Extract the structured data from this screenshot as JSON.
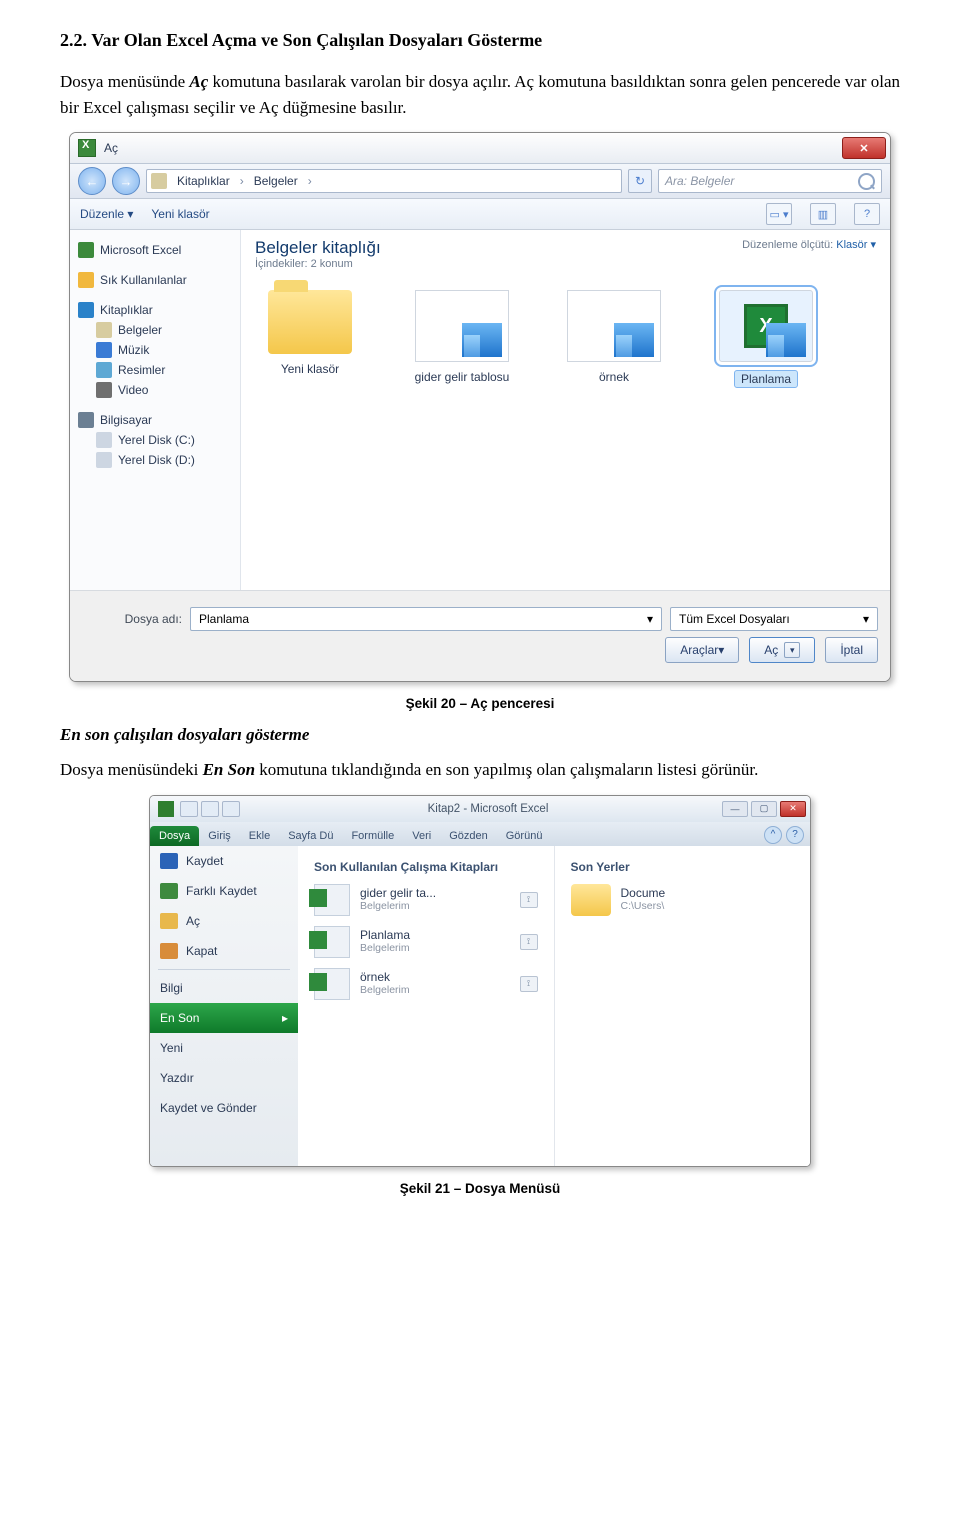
{
  "section": {
    "number": "2.2.",
    "title": "Var  Olan Excel Açma ve Son Çalışılan Dosyaları Gösterme"
  },
  "para1_a": "Dosya menüsünde ",
  "para1_ac": "Aç",
  "para1_b": "  komutuna basılarak varolan bir dosya açılır. Aç komutuna basıldıktan sonra gelen pencerede var olan bir Excel çalışması seçilir ve Aç düğmesine basılır.",
  "fig20_caption": "Şekil 20 – Aç penceresi",
  "subheading": "En son çalışılan dosyaları gösterme",
  "para2_a": "Dosya menüsündeki ",
  "para2_en": "En Son",
  "para2_b": " komutuna tıklandığında en son yapılmış olan çalışmaların listesi görünür.",
  "fig21_caption": "Şekil 21 – Dosya Menüsü",
  "dlg": {
    "title": "Aç",
    "back": "←",
    "fwd": "→",
    "crumbs": [
      "Kitaplıklar",
      "Belgeler"
    ],
    "search_placeholder": "Ara: Belgeler",
    "tools": {
      "organize": "Düzenle ▾",
      "newfolder": "Yeni klasör"
    },
    "lib": {
      "title": "Belgeler kitaplığı",
      "subtitle": "İçindekiler:  2 konum",
      "sort_label": "Düzenleme ölçütü:",
      "sort_value": "Klasör ▾"
    },
    "nav": [
      {
        "t": "Microsoft Excel",
        "cls": "i-xl"
      },
      {
        "t": "Sık Kullanılanlar",
        "cls": "i-star"
      },
      {
        "t": "Kitaplıklar",
        "cls": "i-lib"
      },
      {
        "t": "Belgeler",
        "cls": "i-doc",
        "child": true
      },
      {
        "t": "Müzik",
        "cls": "i-mus",
        "child": true
      },
      {
        "t": "Resimler",
        "cls": "i-pic",
        "child": true
      },
      {
        "t": "Video",
        "cls": "i-vid",
        "child": true
      },
      {
        "t": "Bilgisayar",
        "cls": "i-pc"
      },
      {
        "t": "Yerel Disk (C:)",
        "cls": "i-dsk",
        "child": true
      },
      {
        "t": "Yerel Disk (D:)",
        "cls": "i-dsk",
        "child": true
      }
    ],
    "items": [
      {
        "label": "Yeni klasör",
        "type": "folder"
      },
      {
        "label": "gider gelir tablosu",
        "type": "wb"
      },
      {
        "label": "örnek",
        "type": "wb"
      },
      {
        "label": "Planlama",
        "type": "wb-xl",
        "selected": true
      }
    ],
    "file_label": "Dosya adı:",
    "file_value": "Planlama",
    "filter": "Tüm Excel Dosyaları",
    "tools_btn": "Araçlar",
    "open_btn": "Aç",
    "cancel_btn": "İptal"
  },
  "win": {
    "title": "Kitap2 - Microsoft Excel",
    "tabs": [
      "Dosya",
      "Giriş",
      "Ekle",
      "Sayfa Dü",
      "Formülle",
      "Veri",
      "Gözden",
      "Görünü"
    ],
    "bs": [
      {
        "t": "Kaydet",
        "ico": "bsi-save"
      },
      {
        "t": "Farklı Kaydet",
        "ico": "bsi-saveas"
      },
      {
        "t": "Aç",
        "ico": "bsi-open"
      },
      {
        "t": "Kapat",
        "ico": "bsi-close"
      }
    ],
    "bs2": [
      "Bilgi",
      "En Son",
      "Yeni",
      "Yazdır",
      "Kaydet ve Gönder"
    ],
    "col1_title": "Son Kullanılan Çalışma Kitapları",
    "recents": [
      {
        "name": "gider gelir ta...",
        "loc": "Belgelerim"
      },
      {
        "name": "Planlama",
        "loc": "Belgelerim"
      },
      {
        "name": "örnek",
        "loc": "Belgelerim"
      }
    ],
    "col2_title": "Son Yerler",
    "place": {
      "name": "Docume",
      "loc": "C:\\Users\\"
    }
  }
}
